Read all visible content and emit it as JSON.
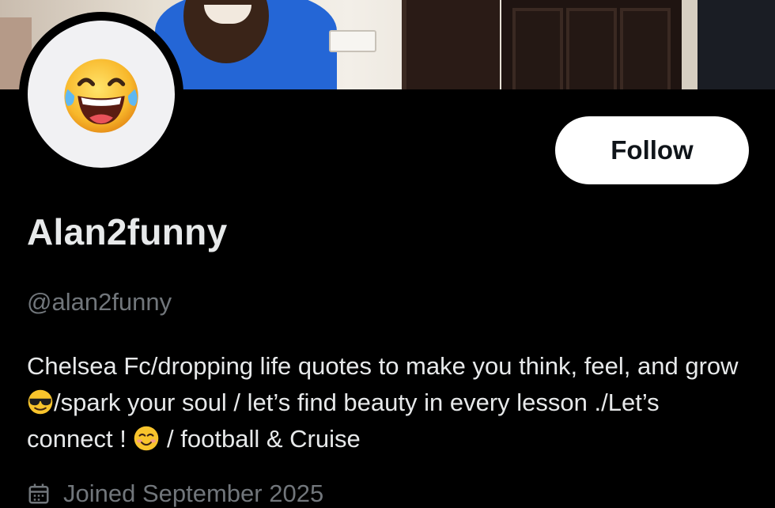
{
  "profile": {
    "display_name": "Alan2funny",
    "handle": "@alan2funny",
    "bio_parts": [
      "Chelsea Fc/dropping life quotes to make you think, feel, and grow",
      "/spark your soul / let’s find beauty in every lesson ./Let’s connect ! ",
      " / football & Cruise"
    ],
    "bio_emojis": [
      "sunglasses-emoji",
      "smiling-face-emoji"
    ],
    "joined_text": "Joined September 2025"
  },
  "actions": {
    "follow_label": "Follow"
  },
  "icons": {
    "avatar": "tears-of-joy-emoji",
    "joined": "calendar-icon"
  },
  "colors": {
    "background": "#000000",
    "primary_text": "#e7e9ea",
    "secondary_text": "#71767b",
    "follow_button_bg": "#ffffff"
  }
}
